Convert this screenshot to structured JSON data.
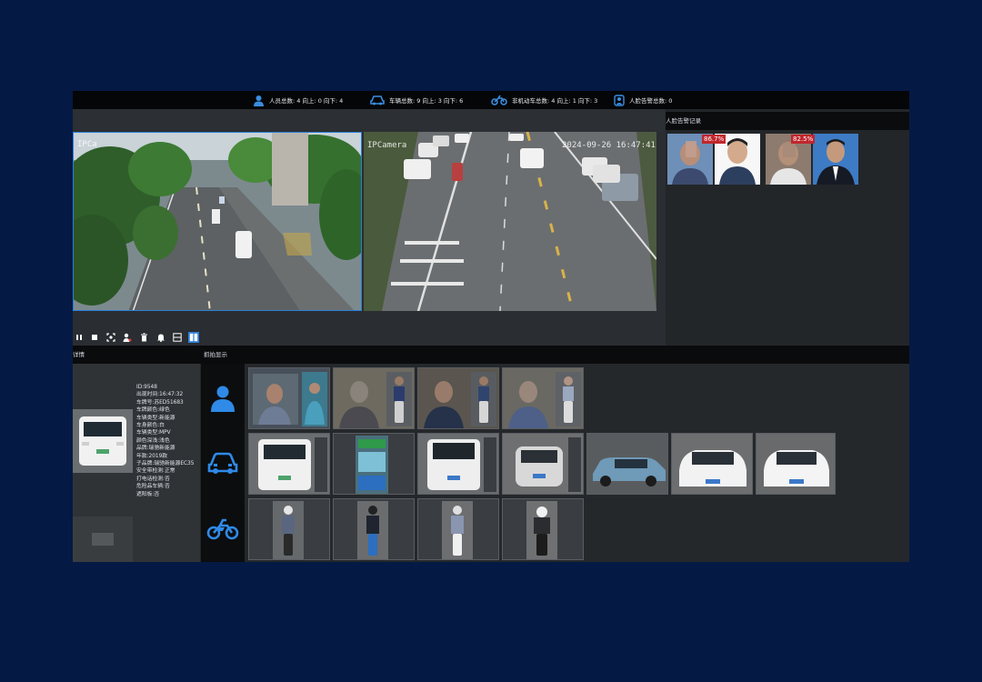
{
  "stats": {
    "person": "人员总数: 4 向上: 0 向下: 4",
    "vehicle": "车辆总数: 9 向上: 3 向下: 6",
    "nonmotor": "非机动车总数: 4 向上: 1 向下: 3",
    "face_alarm": "人脸告警总数: 0"
  },
  "camera2": {
    "osd_name": "IPCamera",
    "osd_time": "2024-09-26 16:47:41"
  },
  "camera1": {
    "osd_name": "IPCa"
  },
  "alarm_panel": {
    "title": "人脸告警记录",
    "items": [
      {
        "score": "86.7%"
      },
      {
        "score": "82.5%"
      }
    ]
  },
  "lower": {
    "detail_title": "详情",
    "capture_title": "抓拍显示",
    "detail": [
      "ID:9548",
      "出现时间:16:47:32",
      "车牌号:苏ED51683",
      "车牌颜色:绿色",
      "车辆类型:新能源",
      "车身颜色:白",
      "车辆类型:MPV",
      "颜色深浅:浅色",
      "品牌:瑞驰新能源",
      "年款:2019款",
      "子品牌:瑞驰新能源EC35",
      "安全带检测:正常",
      "打电话检测:否",
      "危险品车辆:否",
      "遮阳板:否"
    ]
  },
  "colors": {
    "accent": "#2d7fd6",
    "score_bg": "#c0262d",
    "bg": "#041a44"
  },
  "icons": [
    "person-icon",
    "car-icon",
    "motorcycle-icon",
    "face-alarm-icon",
    "pause-icon",
    "stop-icon",
    "capture-icon",
    "record-icon",
    "delete-icon",
    "bell-icon",
    "layout-1-icon",
    "layout-2-icon"
  ]
}
